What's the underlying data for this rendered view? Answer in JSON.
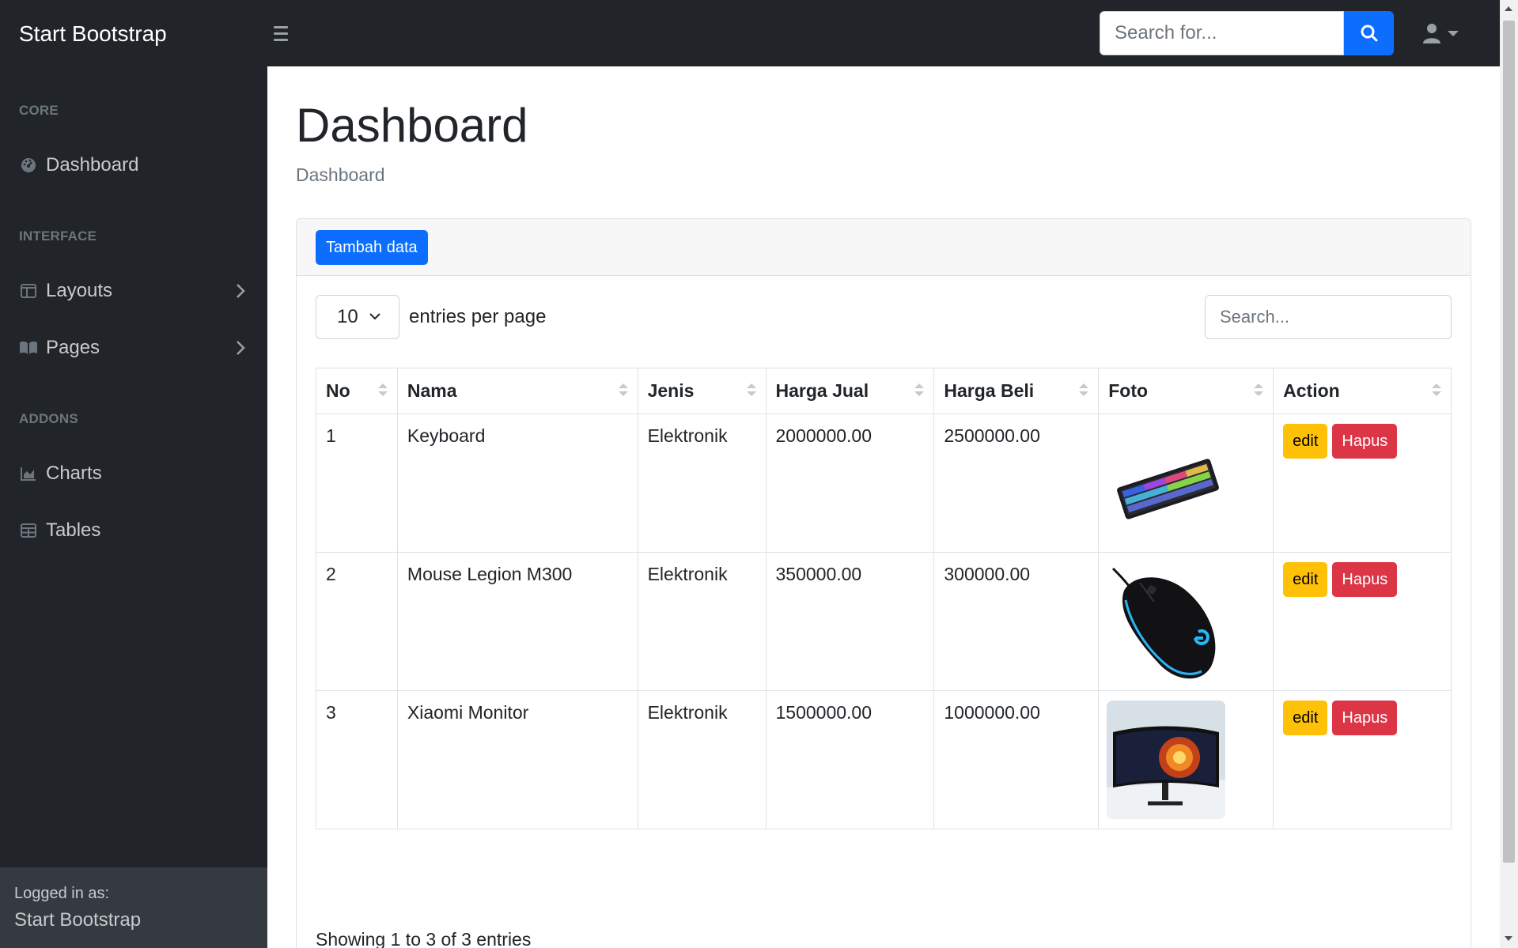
{
  "navbar": {
    "brand": "Start Bootstrap",
    "search_placeholder": "Search for..."
  },
  "sidebar": {
    "headings": [
      "CORE",
      "INTERFACE",
      "ADDONS"
    ],
    "items": [
      {
        "label": "Dashboard",
        "icon": "dashboard-icon"
      },
      {
        "label": "Layouts",
        "icon": "columns-icon"
      },
      {
        "label": "Pages",
        "icon": "book-icon"
      },
      {
        "label": "Charts",
        "icon": "chart-area-icon"
      },
      {
        "label": "Tables",
        "icon": "table-icon"
      }
    ],
    "footer": {
      "small": "Logged in as:",
      "name": "Start Bootstrap"
    }
  },
  "main": {
    "title": "Dashboard",
    "breadcrumb": "Dashboard",
    "add_button": "Tambah data",
    "entries_value": "10",
    "entries_label": "entries per page",
    "search_placeholder": "Search...",
    "columns": [
      "No",
      "Nama",
      "Jenis",
      "Harga Jual",
      "Harga Beli",
      "Foto",
      "Action"
    ],
    "rows": [
      {
        "no": "1",
        "nama": "Keyboard",
        "jenis": "Elektronik",
        "harga_jual": "2000000.00",
        "harga_beli": "2500000.00",
        "foto": "keyboard-photo"
      },
      {
        "no": "2",
        "nama": "Mouse Legion M300",
        "jenis": "Elektronik",
        "harga_jual": "350000.00",
        "harga_beli": "300000.00",
        "foto": "mouse-photo"
      },
      {
        "no": "3",
        "nama": "Xiaomi Monitor",
        "jenis": "Elektronik",
        "harga_jual": "1500000.00",
        "harga_beli": "1000000.00",
        "foto": "monitor-photo"
      }
    ],
    "edit_label": "edit",
    "delete_label": "Hapus",
    "showing": "Showing 1 to 3 of 3 entries"
  },
  "colors": {
    "dark": "#212529",
    "primary": "#0d6efd",
    "warning": "#ffc107",
    "danger": "#dc3545"
  }
}
